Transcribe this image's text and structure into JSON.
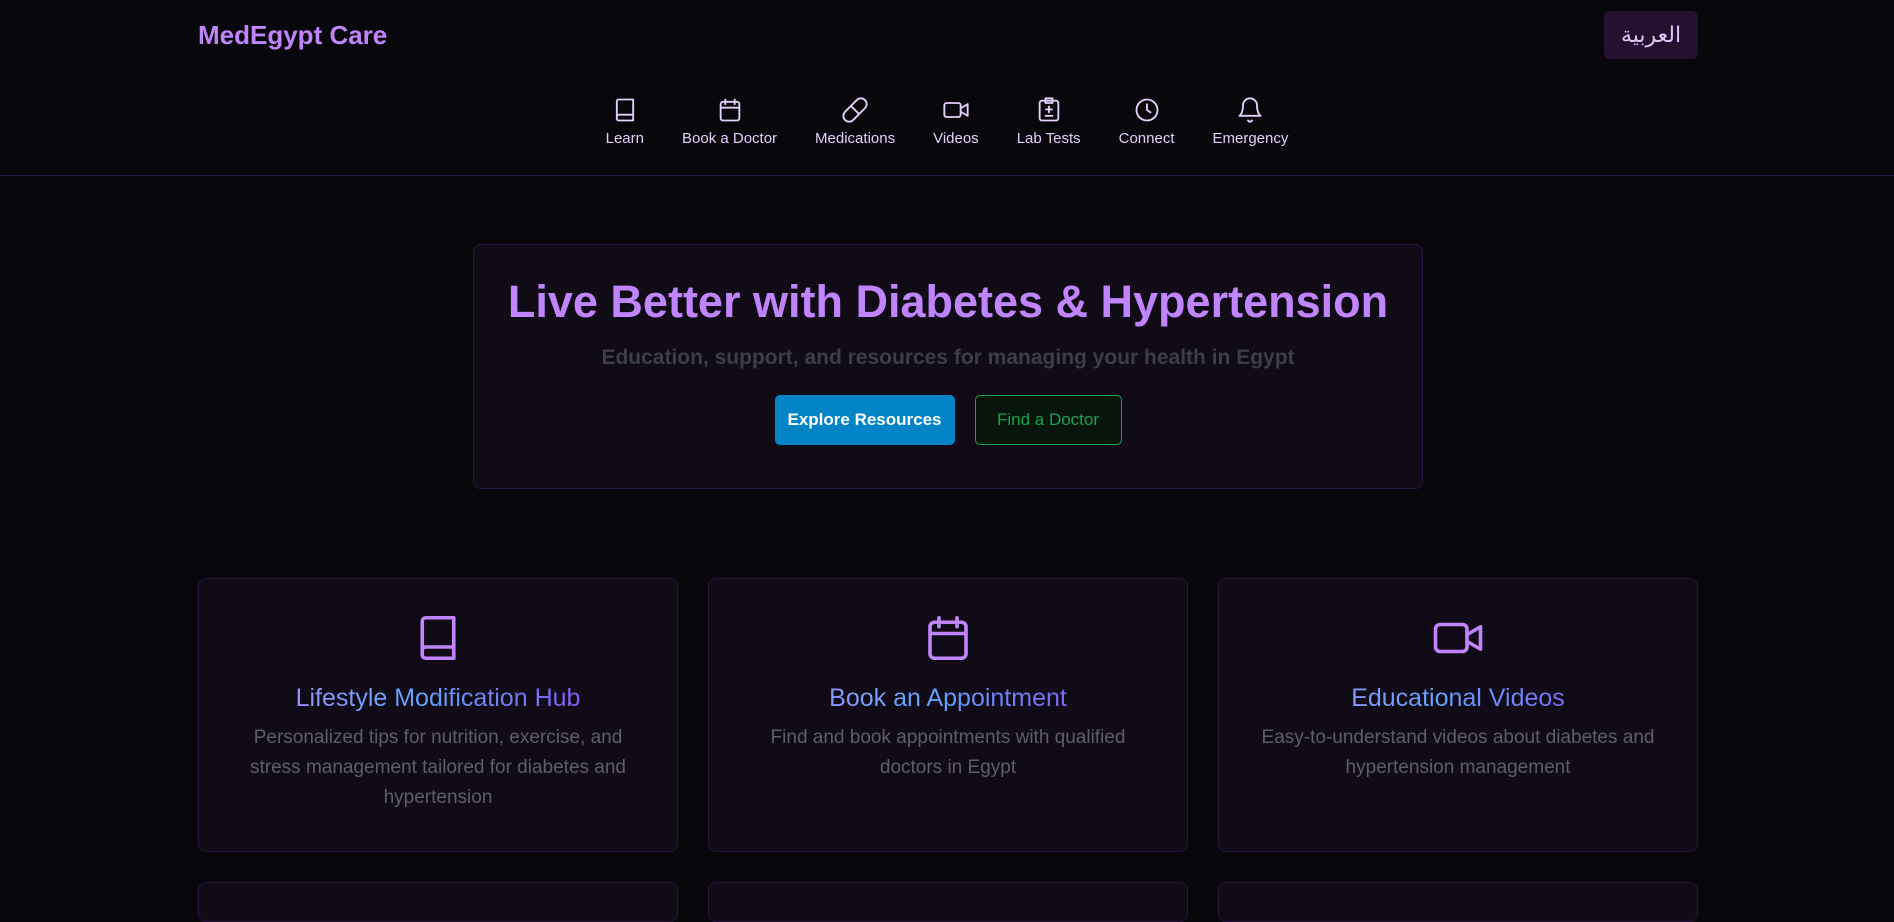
{
  "header": {
    "brand": "MedEgypt Care",
    "language_button": "العربية"
  },
  "nav": {
    "items": [
      {
        "label": "Learn",
        "icon": "book-icon"
      },
      {
        "label": "Book a Doctor",
        "icon": "calendar-icon"
      },
      {
        "label": "Medications",
        "icon": "pill-icon"
      },
      {
        "label": "Videos",
        "icon": "video-icon"
      },
      {
        "label": "Lab Tests",
        "icon": "lab-test-icon"
      },
      {
        "label": "Connect",
        "icon": "clock-icon"
      },
      {
        "label": "Emergency",
        "icon": "bell-icon"
      }
    ]
  },
  "hero": {
    "title": "Live Better with Diabetes & Hypertension",
    "subtitle": "Education, support, and resources for managing your health in Egypt",
    "primary_button": "Explore Resources",
    "secondary_button": "Find a Doctor"
  },
  "cards": [
    {
      "icon": "book-icon",
      "title": "Lifestyle Modification Hub",
      "description": "Personalized tips for nutrition, exercise, and stress management tailored for diabetes and hypertension"
    },
    {
      "icon": "calendar-icon",
      "title": "Book an Appointment",
      "description": "Find and book appointments with qualified doctors in Egypt"
    },
    {
      "icon": "video-icon",
      "title": "Educational Videos",
      "description": "Easy-to-understand videos about diabetes and hypertension management"
    }
  ],
  "colors": {
    "accent": "#c084fc",
    "background": "#08070b",
    "card_background": "#110a17",
    "primary_button": "#0284c7",
    "secondary_button": "#16a34a"
  }
}
